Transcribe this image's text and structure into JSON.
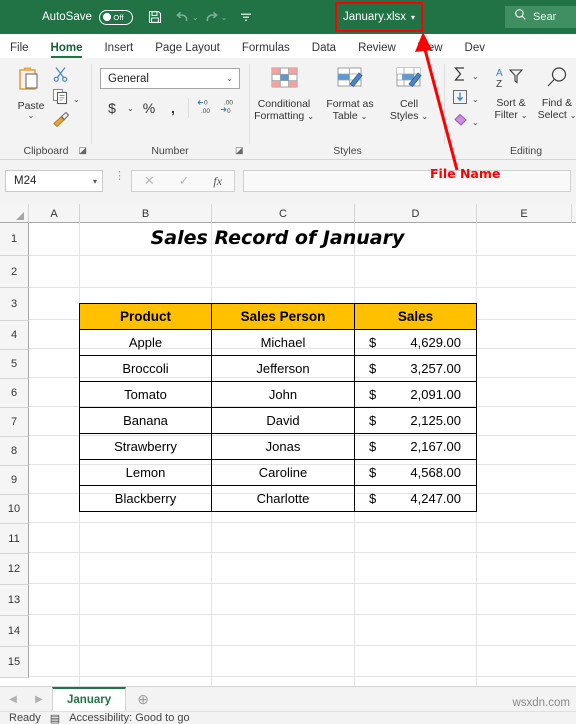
{
  "titlebar": {
    "autosave_label": "AutoSave",
    "autosave_state": "Off",
    "save_icon": "save-icon",
    "undo_icon": "undo-icon",
    "redo_icon": "redo-icon",
    "more_icon": "customize-quick-access-icon",
    "filename": "January.xlsx",
    "filename_chevron": "▾",
    "highlight_color": "#ff0000",
    "bar_color": "#217346"
  },
  "search": {
    "icon": "search-icon",
    "placeholder": "Sear"
  },
  "tabs": [
    {
      "label": "File",
      "active": false
    },
    {
      "label": "Home",
      "active": true
    },
    {
      "label": "Insert",
      "active": false
    },
    {
      "label": "Page Layout",
      "active": false
    },
    {
      "label": "Formulas",
      "active": false
    },
    {
      "label": "Data",
      "active": false
    },
    {
      "label": "Review",
      "active": false
    },
    {
      "label": "View",
      "active": false
    },
    {
      "label": "Dev",
      "active": false
    }
  ],
  "ribbon": {
    "clipboard": {
      "group_label": "Clipboard",
      "paste_label": "Paste",
      "paste_chevron": "⌄",
      "paste_icon": "paste-clipboard-icon",
      "cut_icon": "scissors-cut-icon",
      "copy_icon": "copy-icon",
      "copy_chevron": "⌄",
      "format_painter_icon": "format-painter-brush-icon",
      "dialog_launcher": "◪"
    },
    "number": {
      "group_label": "Number",
      "format_value": "General",
      "format_chevron": "⌄",
      "currency_icon": "currency-dollar-icon",
      "currency_chevron": "⌄",
      "percent_icon": "percent-style-icon",
      "comma_icon": "comma-style-icon",
      "decrease_decimal_icon": "decrease-decimal-icon",
      "increase_decimal_icon": "increase-decimal-icon",
      "dialog_launcher": "◪"
    },
    "styles": {
      "group_label": "Styles",
      "items": [
        {
          "label_line1": "Conditional",
          "label_line2": "Formatting",
          "chevron": "⌄",
          "icon": "conditional-formatting-icon"
        },
        {
          "label_line1": "Format as",
          "label_line2": "Table",
          "chevron": "⌄",
          "icon": "format-as-table-icon"
        },
        {
          "label_line1": "Cell",
          "label_line2": "Styles",
          "chevron": "⌄",
          "icon": "cell-styles-icon"
        }
      ]
    },
    "editing": {
      "group_label": "Editing",
      "autosum_icon": "autosum-sigma-icon",
      "autosum_chevron": "⌄",
      "fill_icon": "fill-down-icon",
      "fill_chevron": "⌄",
      "clear_icon": "clear-eraser-icon",
      "clear_chevron": "⌄",
      "sort_filter": {
        "label_line1": "Sort &",
        "label_line2": "Filter",
        "chevron": "⌄",
        "icon": "sort-filter-icon"
      },
      "find_select": {
        "label_line1": "Find &",
        "label_line2": "Select",
        "chevron": "⌄",
        "icon": "find-select-magnifier-icon"
      }
    }
  },
  "formula_bar": {
    "name_box_value": "M24",
    "name_box_chevron": "▾",
    "cancel_icon": "cancel-x-icon",
    "enter_icon": "enter-check-icon",
    "function_icon": "insert-function-fx-icon",
    "function_label": "fx",
    "formula_value": ""
  },
  "annotation": {
    "label": "File Name",
    "color": "#ff0000",
    "arrow_icon": "callout-arrow-icon"
  },
  "grid": {
    "columns": [
      {
        "label": "A",
        "width": 51
      },
      {
        "label": "B",
        "width": 132
      },
      {
        "label": "C",
        "width": 143
      },
      {
        "label": "D",
        "width": 122
      },
      {
        "label": "E",
        "width": 95
      }
    ],
    "rows": [
      {
        "label": "1",
        "height": 33
      },
      {
        "label": "2",
        "height": 32
      },
      {
        "label": "3",
        "height": 33
      },
      {
        "label": "4",
        "height": 29
      },
      {
        "label": "5",
        "height": 29
      },
      {
        "label": "6",
        "height": 29
      },
      {
        "label": "7",
        "height": 29
      },
      {
        "label": "8",
        "height": 29
      },
      {
        "label": "9",
        "height": 29
      },
      {
        "label": "10",
        "height": 29
      },
      {
        "label": "11",
        "height": 30
      },
      {
        "label": "12",
        "height": 31
      },
      {
        "label": "13",
        "height": 31
      },
      {
        "label": "14",
        "height": 31
      },
      {
        "label": "15",
        "height": 31
      }
    ],
    "sheet_title": "Sales Record of January",
    "header_fill": "#FFC000"
  },
  "table": {
    "headers": [
      "Product",
      "Sales Person",
      "Sales"
    ],
    "rows": [
      {
        "product": "Apple",
        "person": "Michael",
        "currency": "$",
        "sales": "4,629.00"
      },
      {
        "product": "Broccoli",
        "person": "Jefferson",
        "currency": "$",
        "sales": "3,257.00"
      },
      {
        "product": "Tomato",
        "person": "John",
        "currency": "$",
        "sales": "2,091.00"
      },
      {
        "product": "Banana",
        "person": "David",
        "currency": "$",
        "sales": "2,125.00"
      },
      {
        "product": "Strawberry",
        "person": "Jonas",
        "currency": "$",
        "sales": "2,167.00"
      },
      {
        "product": "Lemon",
        "person": "Caroline",
        "currency": "$",
        "sales": "4,568.00"
      },
      {
        "product": "Blackberry",
        "person": "Charlotte",
        "currency": "$",
        "sales": "4,247.00"
      }
    ]
  },
  "sheet_tabs": {
    "prev_icon": "previous-sheet-arrow-icon",
    "next_icon": "next-sheet-arrow-icon",
    "tabs": [
      {
        "label": "January",
        "active": true
      }
    ],
    "add_icon": "add-sheet-plus-icon",
    "add_label": "⊕"
  },
  "status_bar": {
    "ready_label": "Ready",
    "accessibility_icon": "accessibility-icon",
    "accessibility_label": "Accessibility: Good to go"
  },
  "watermark": {
    "text": "wsxdn.com"
  }
}
